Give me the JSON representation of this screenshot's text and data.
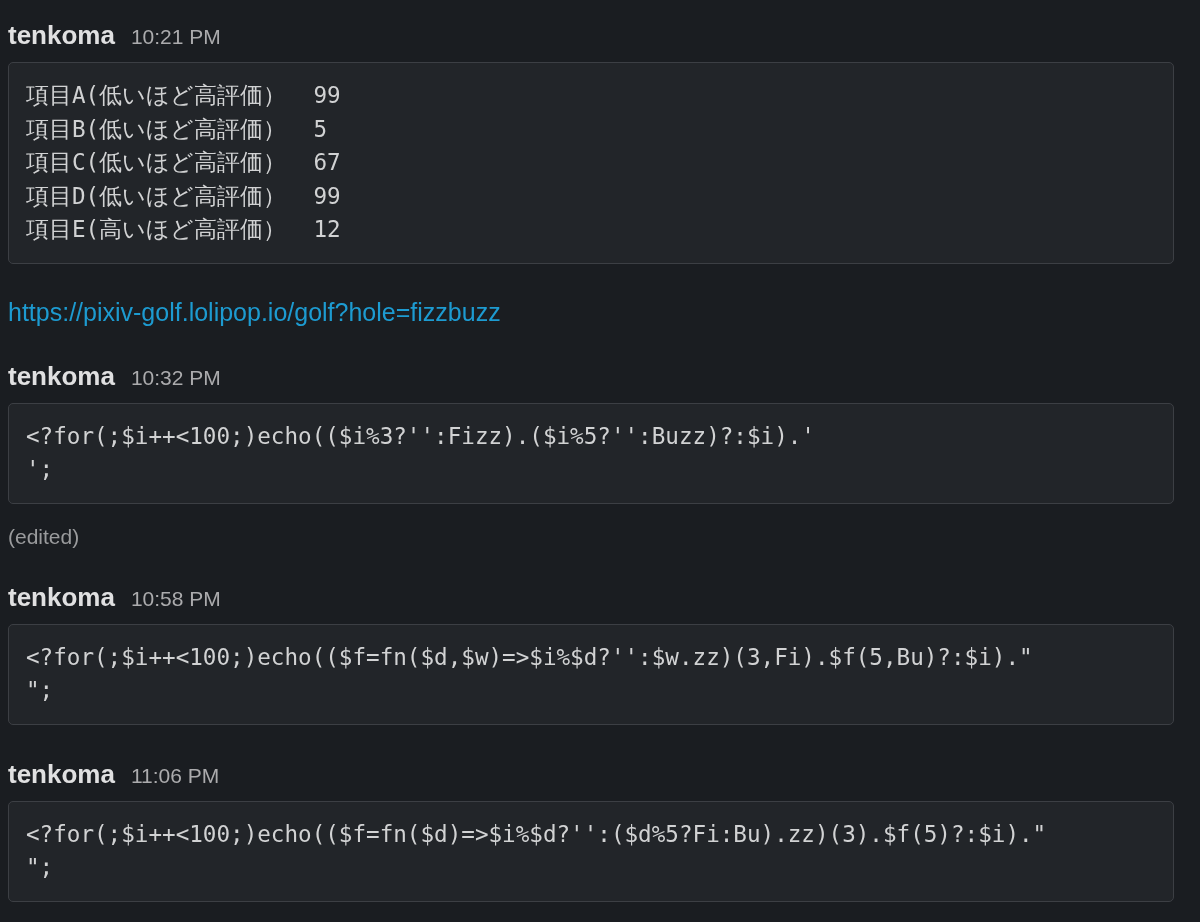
{
  "messages": [
    {
      "author": "tenkoma",
      "time": "10:21 PM",
      "parts": [
        {
          "kind": "code",
          "text": "項目A(低いほど高評価）  99\n項目B(低いほど高評価）  5\n項目C(低いほど高評価）  67\n項目D(低いほど高評価）  99\n項目E(高いほど高評価）  12"
        },
        {
          "kind": "link",
          "text": "https://pixiv-golf.lolipop.io/golf?hole=fizzbuzz"
        }
      ]
    },
    {
      "author": "tenkoma",
      "time": "10:32 PM",
      "parts": [
        {
          "kind": "code",
          "text": "<?for(;$i++<100;)echo(($i%3?'':Fizz).($i%5?'':Buzz)?:$i).'\n';"
        },
        {
          "kind": "edited",
          "text": "(edited)"
        }
      ]
    },
    {
      "author": "tenkoma",
      "time": "10:58 PM",
      "parts": [
        {
          "kind": "code",
          "text": "<?for(;$i++<100;)echo(($f=fn($d,$w)=>$i%$d?'':$w.zz)(3,Fi).$f(5,Bu)?:$i).\"\n\";"
        }
      ]
    },
    {
      "author": "tenkoma",
      "time": "11:06 PM",
      "parts": [
        {
          "kind": "code",
          "text": "<?for(;$i++<100;)echo(($f=fn($d)=>$i%$d?'':($d%5?Fi:Bu).zz)(3).$f(5)?:$i).\"\n\";"
        }
      ]
    }
  ]
}
